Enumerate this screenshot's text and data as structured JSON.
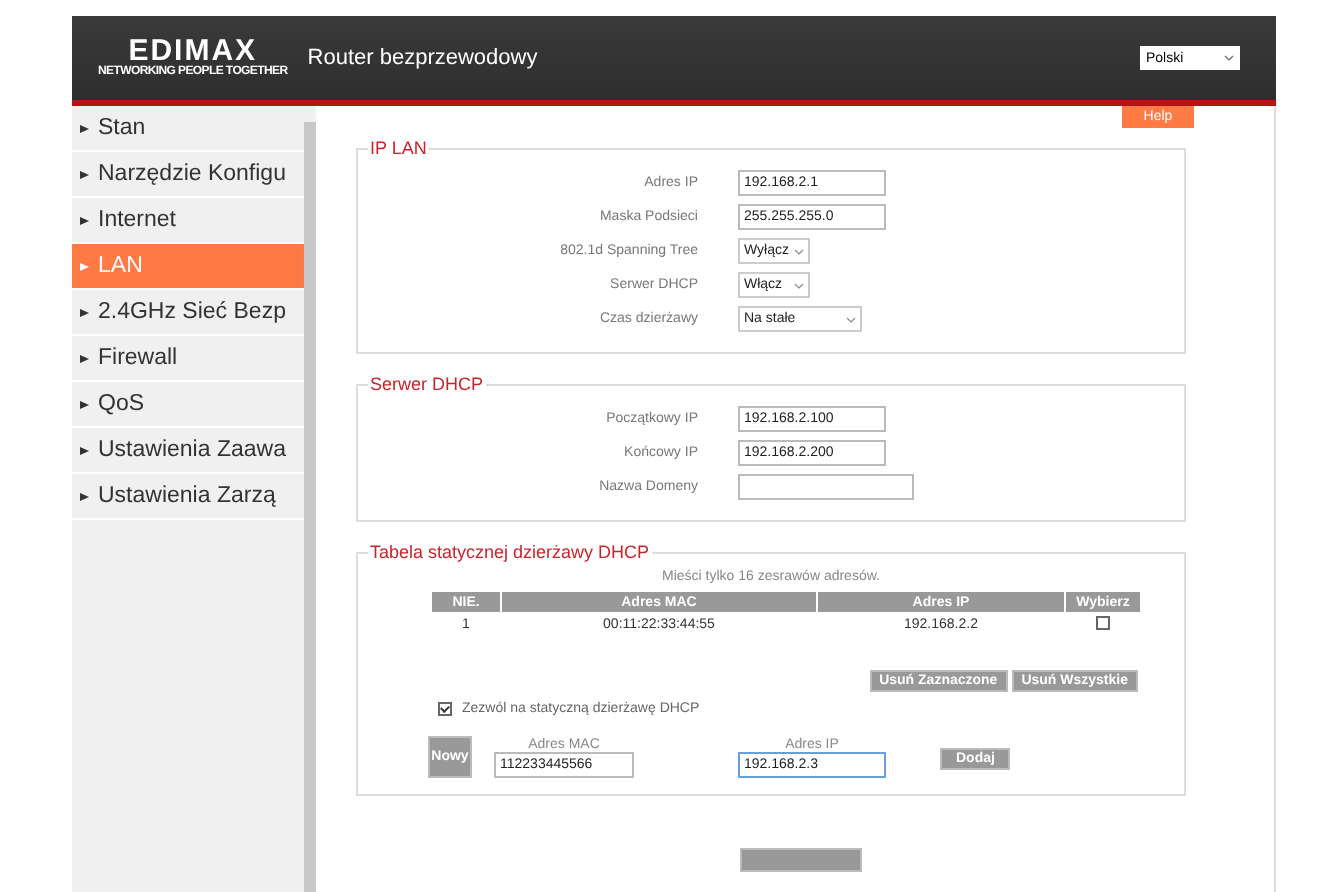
{
  "header": {
    "brand": "EDIMAX",
    "tagline": "NETWORKING PEOPLE TOGETHER",
    "title": "Router bezprzewodowy",
    "language": "Polski"
  },
  "sidebar": {
    "items": [
      {
        "label": "Stan",
        "selected": false
      },
      {
        "label": "Narzędzie Konfigu",
        "selected": false
      },
      {
        "label": "Internet",
        "selected": false
      },
      {
        "label": "LAN",
        "selected": true
      },
      {
        "label": "2.4GHz Sieć Bezp",
        "selected": false
      },
      {
        "label": "Firewall",
        "selected": false
      },
      {
        "label": "QoS",
        "selected": false
      },
      {
        "label": "Ustawienia Zaawa",
        "selected": false
      },
      {
        "label": "Ustawienia Zarzą",
        "selected": false
      }
    ]
  },
  "help_button": "Help",
  "ip_lan": {
    "legend": "IP LAN",
    "fields": [
      {
        "label": "Adres IP",
        "kind": "input",
        "value": "192.168.2.1"
      },
      {
        "label": "Maska Podsieci",
        "kind": "input",
        "value": "255.255.255.0"
      },
      {
        "label": "802.1d Spanning Tree",
        "kind": "select",
        "value": "Wyłącz"
      },
      {
        "label": "Serwer DHCP",
        "kind": "select",
        "value": "Włącz"
      },
      {
        "label": "Czas dzierżawy",
        "kind": "select",
        "value": "Na stałe"
      }
    ]
  },
  "dhcp_server": {
    "legend": "Serwer DHCP",
    "fields": [
      {
        "label": "Początkowy IP",
        "kind": "input",
        "value": "192.168.2.100"
      },
      {
        "label": "Końcowy IP",
        "kind": "input",
        "value": "192.168.2.200"
      },
      {
        "label": "Nazwa Domeny",
        "kind": "input"
      }
    ]
  },
  "static_lease": {
    "legend": "Tabela statycznej dzierżawy DHCP",
    "note": "Mieści tylko 16 zesrawów adresów.",
    "columns": [
      "NIE.",
      "Adres MAC",
      "Adres IP",
      "Wybierz"
    ],
    "rows": [
      {
        "no": "1",
        "mac": "00:11:22:33:44:55",
        "ip": "192.168.2.2",
        "selected": false
      }
    ],
    "buttons": [
      "Usuń Zaznaczone",
      "Usuń Wszystkie"
    ],
    "enable": {
      "label": "Zezwól na statyczną dzierżawę DHCP",
      "checked": true
    },
    "new_entry": {
      "button": "Nowy",
      "mac_label": "Adres MAC",
      "mac_value": "112233445566",
      "ip_label": "Adres IP",
      "ip_value": "192.168.2.3",
      "add_button": "Dodaj"
    }
  }
}
